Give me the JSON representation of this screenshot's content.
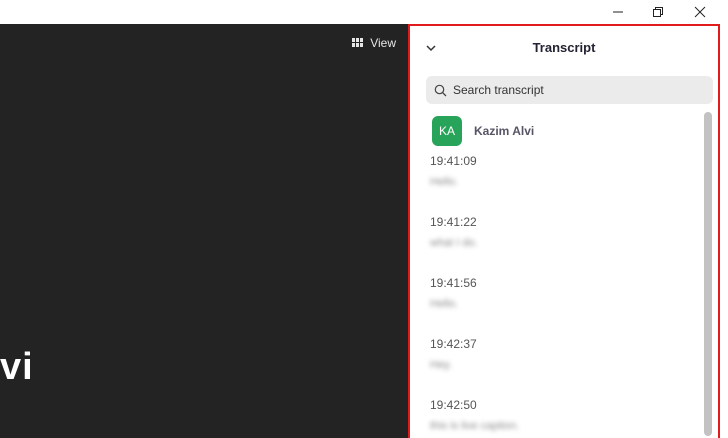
{
  "window": {
    "controls": [
      "minimize",
      "restore",
      "close"
    ]
  },
  "video": {
    "view_label": "View",
    "name_fragment": "vi"
  },
  "transcript": {
    "title": "Transcript",
    "search_placeholder": "Search transcript",
    "speaker": {
      "initials": "KA",
      "name": "Kazim Alvi",
      "avatar_color": "#28a45a"
    },
    "entries": [
      {
        "time": "19:41:09",
        "text": "Hello."
      },
      {
        "time": "19:41:22",
        "text": "what I do."
      },
      {
        "time": "19:41:56",
        "text": "Hello."
      },
      {
        "time": "19:42:37",
        "text": "Hey."
      },
      {
        "time": "19:42:50",
        "text": "this is live caption."
      }
    ]
  },
  "colors": {
    "highlight_border": "#e11b1b",
    "video_bg": "#232323"
  }
}
